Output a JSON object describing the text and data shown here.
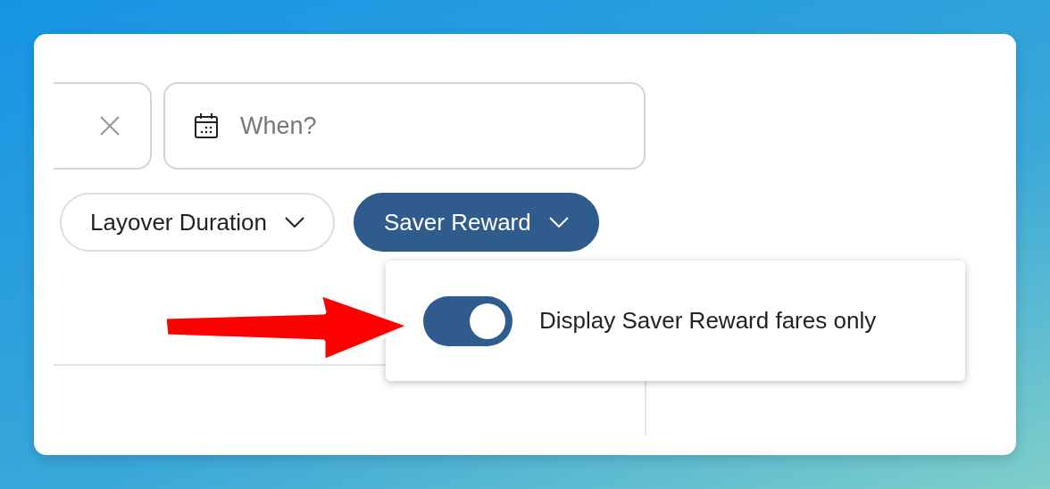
{
  "search_fields": [
    {
      "kind": "clearable"
    },
    {
      "kind": "date",
      "placeholder": "When?"
    }
  ],
  "filters": [
    {
      "label": "Layover Duration",
      "selected": false
    },
    {
      "label": "Saver Reward",
      "selected": true
    }
  ],
  "dropdown": {
    "toggle": {
      "label": "Display Saver Reward fares only",
      "on": true
    }
  }
}
